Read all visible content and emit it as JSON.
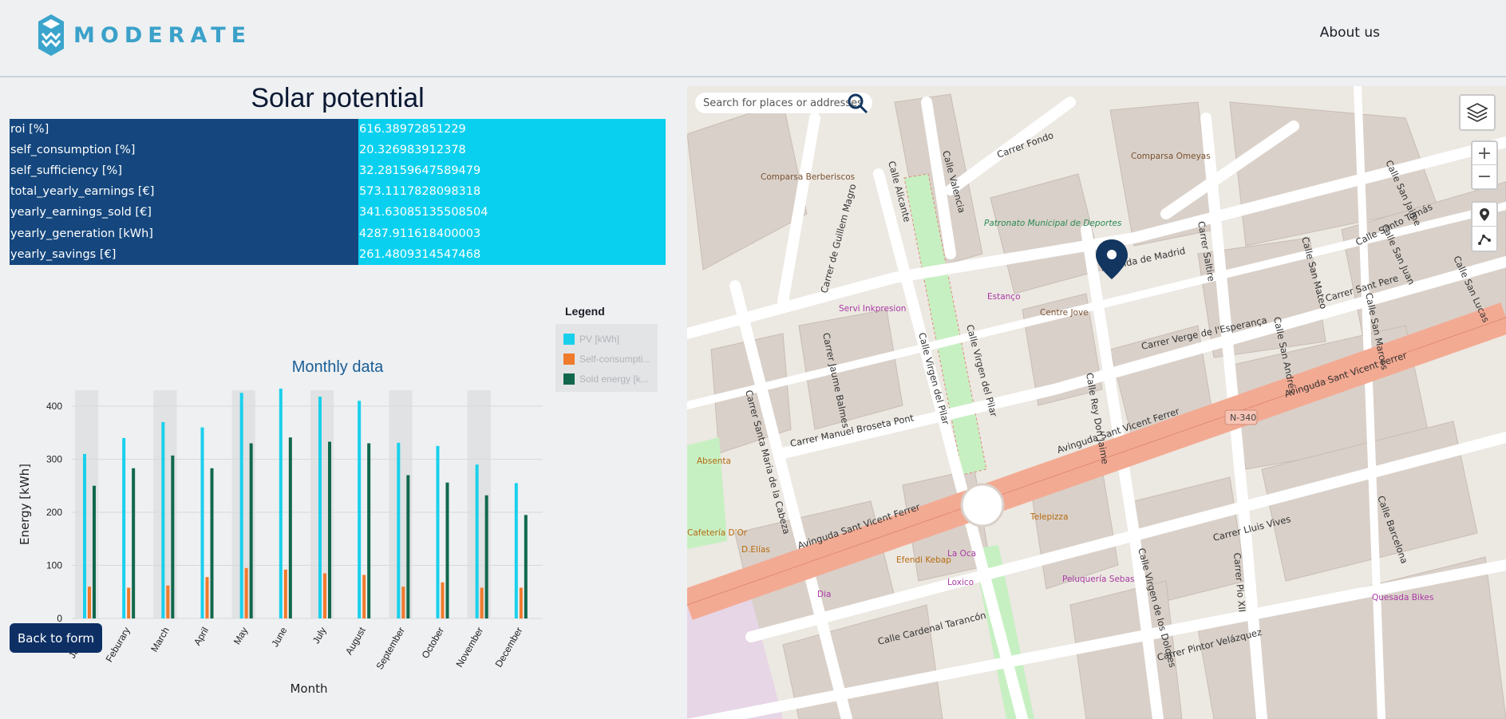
{
  "header": {
    "brand": "MODERATE",
    "about_label": "About us"
  },
  "page": {
    "title": "Solar potential",
    "back_label": "Back to form"
  },
  "kpis": [
    {
      "key": "roi [%]",
      "value": "616.38972851229"
    },
    {
      "key": "self_consumption [%]",
      "value": "20.326983912378"
    },
    {
      "key": "self_sufficiency [%]",
      "value": "32.28159647589479"
    },
    {
      "key": "total_yearly_earnings [€]",
      "value": "573.1117828098318"
    },
    {
      "key": "yearly_earnings_sold [€]",
      "value": "341.63085135508504"
    },
    {
      "key": "yearly_generation [kWh]",
      "value": "4287.911618400003"
    },
    {
      "key": "yearly_savings [€]",
      "value": "261.4809314547468"
    }
  ],
  "chart_data": {
    "type": "bar",
    "title": "Monthly data",
    "xlabel": "Month",
    "ylabel": "Energy [kWh]",
    "ylim": [
      0,
      430
    ],
    "yticks": [
      0,
      100,
      200,
      300,
      400
    ],
    "categories": [
      "January",
      "Feburary",
      "March",
      "April",
      "May",
      "June",
      "July",
      "August",
      "September",
      "October",
      "November",
      "December"
    ],
    "series": [
      {
        "name": "PV [kWh]",
        "color": "#19d0ec",
        "values": [
          310,
          340,
          370,
          360,
          425,
          433,
          418,
          410,
          331,
          325,
          290,
          255
        ]
      },
      {
        "name": "Self-consumpti...",
        "color": "#f07a2b",
        "values": [
          60,
          58,
          62,
          78,
          95,
          92,
          85,
          82,
          60,
          68,
          58,
          58
        ]
      },
      {
        "name": "Sold energy [k...",
        "color": "#11684c",
        "values": [
          250,
          283,
          307,
          283,
          330,
          341,
          333,
          330,
          270,
          256,
          232,
          195
        ]
      }
    ],
    "legend_title": "Legend",
    "legend_position": "right",
    "grid": true
  },
  "map": {
    "search_placeholder": "Search for places or addresses",
    "zoom_in": "+",
    "zoom_out": "−",
    "labels": [
      "Avenida de Madrid",
      "Carrer Verge de l'Esperança",
      "Carrer Manuel Broseta Pont",
      "Avinguda Sant Vicent Ferrer",
      "Calle Cardenal Tarancón",
      "Carrer Lluis Vives",
      "Carrer Pintor Velázquez",
      "Carrer Sant Pere",
      "Calle Santo Tomás",
      "Carrer Fondo",
      "Calle Alicante",
      "Calle Valencia",
      "Carrer de Guillem Magro",
      "Carrer Jaume Balmes",
      "Calle Virgen del Pilar",
      "Calle Rey Don Jaime",
      "Carrer Saltire",
      "Calle San Mateo",
      "Calle San Jaime",
      "Calle San Juan",
      "Calle San Marcos",
      "Calle San Lucas",
      "Calle San Andrés",
      "Carrer Santa Maria de la Cabeza",
      "Calle Virgen de los Dolores",
      "Carrer Pio XII",
      "Calle Barcelona",
      "N-340",
      "Servi Inkpresion",
      "Estanço",
      "Centre Jove",
      "Comparsa Omeyas",
      "Comparsa Berberiscos",
      "Patronato Municipal de Deportes",
      "Telepizza",
      "Efendi Kebap",
      "La Oca",
      "Loxico",
      "Dia",
      "Peluquería Sebas",
      "Quesada Bikes",
      "Absenta",
      "Cafetería D'Or",
      "D.Elías"
    ]
  }
}
